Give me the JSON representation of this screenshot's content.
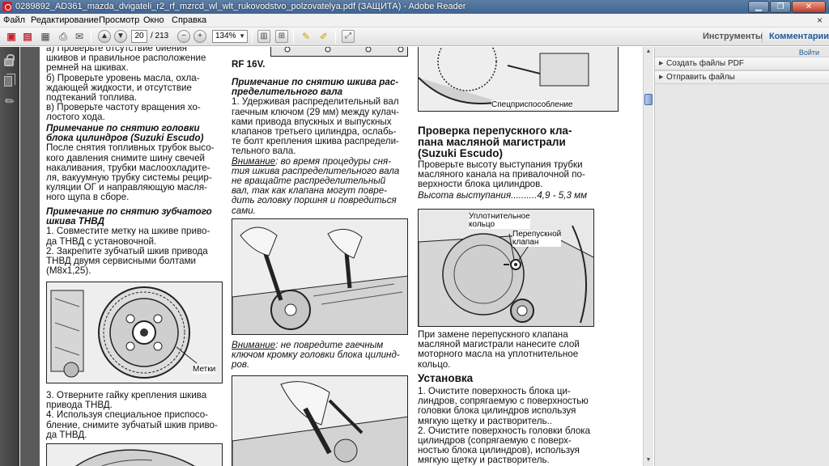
{
  "window": {
    "title": "0289892_AD361_mazda_dvigateli_r2_rf_mzrcd_wl_wlt_rukovodstvo_polzovatelya.pdf (ЗАЩИТА) - Adobe Reader",
    "minimize": "▁",
    "maximize": "❐",
    "close": "✕"
  },
  "menu": {
    "items": [
      "Файл",
      "Редактирование",
      "Просмотр",
      "Окно",
      "Справка"
    ],
    "close_x": "×"
  },
  "toolbar": {
    "page_current": "20",
    "page_total": "/ 213",
    "zoom": "134%",
    "tools_tab": "Инструменты",
    "comments_tab": "Комментарии"
  },
  "right_pane": {
    "go_label": "Войти",
    "items": [
      "Создать файлы PDF",
      "Отправить файлы"
    ]
  },
  "document": {
    "col1": {
      "p_top": [
        "а) Проверьте отсутствие биения",
        "шкивов и правильное расположение",
        "ремней на шкивах.",
        "б) Проверьте уровень масла, охла-",
        "ждающей жидкости, и отсутствие",
        "подтеканий топлива.",
        "в) Проверьте частоту вращения хо-",
        "лостого хода."
      ],
      "h1": [
        "Примечание по снятию головки",
        "блока цилиндров (Suzuki Escudo)"
      ],
      "p1": [
        "После снятия топливных трубок высо-",
        "кого давления снимите шину свечей",
        "накаливания, трубки маслоохладите-",
        "ля, вакуумную трубку системы рецир-",
        "куляции ОГ и направляющую масля-",
        "ного щупа в сборе."
      ],
      "h2": [
        "Примечание по снятию зубчатого",
        "шкива ТНВД"
      ],
      "p2": [
        "1. Совместите метку на шкиве приво-",
        "да ТНВД с установочной.",
        "2. Закрепите зубчатый шкив привода",
        "ТНВД двумя сервисными болтами",
        "(M8x1,25)."
      ],
      "fig_label": "Метки",
      "p3": [
        "3. Отверните гайку крепления шкива",
        "привода ТНВД.",
        "4. Используя специальное приспосо-",
        "бление, снимите зубчатый шкив приво-",
        "да ТНВД."
      ]
    },
    "col2": {
      "top_label": "RF 16V.",
      "h1": [
        "Примечание по снятию шкива рас-",
        "пределительного вала"
      ],
      "p1": [
        "1. Удерживая распределительный вал",
        "гаечным ключом (29 мм) между кулач-",
        "ками привода впускных и выпускных",
        "клапанов третьего цилиндра, ослабь-",
        "те болт крепления шкива распредели-",
        "тельного вала."
      ],
      "warn1_word": "Внимание",
      "warn1": [
        ": во время процедуры сня-",
        "тия шкива распределительного вала",
        "не вращайте распределительный",
        "вал, так как клапана могут повре-",
        "дить головку поршня и повредиться",
        "сами."
      ],
      "warn2_word": "Внимание",
      "warn2": [
        ": не повредите гаечным",
        "ключом кромку головки блока цилинд-",
        "ров."
      ]
    },
    "col3": {
      "fig_label_top": "Спецприспособление",
      "h1": [
        "Проверка перепускного кла-",
        "пана масляной магистрали",
        "(Suzuki Escudo)"
      ],
      "p1": [
        "Проверьте высоту выступания трубки",
        "масляного канала на привалочной по-",
        "верхности блока цилиндров."
      ],
      "spec_label": "Высота выступания..........",
      "spec_value": "4,9 - 5,3 мм",
      "fig_label_seal": [
        "Уплотнительное",
        "кольцо"
      ],
      "fig_label_valve": [
        "Перепускной",
        "клапан"
      ],
      "p2": [
        "При замене перепускного клапана",
        "масляной магистрали нанесите слой",
        "моторного масла на уплотнительное",
        "кольцо."
      ],
      "h2": "Установка",
      "p3": [
        "1. Очистите поверхность блока ци-",
        "линдров, сопрягаемую с поверхностью",
        "головки блока цилиндров используя",
        "мягкую щетку и растворитель..",
        "2. Очистите поверхность головки блока",
        "цилиндров (сопрягаемую с поверх-",
        "ностью блока цилиндров), используя",
        "мягкую щетку и растворитель."
      ]
    }
  }
}
